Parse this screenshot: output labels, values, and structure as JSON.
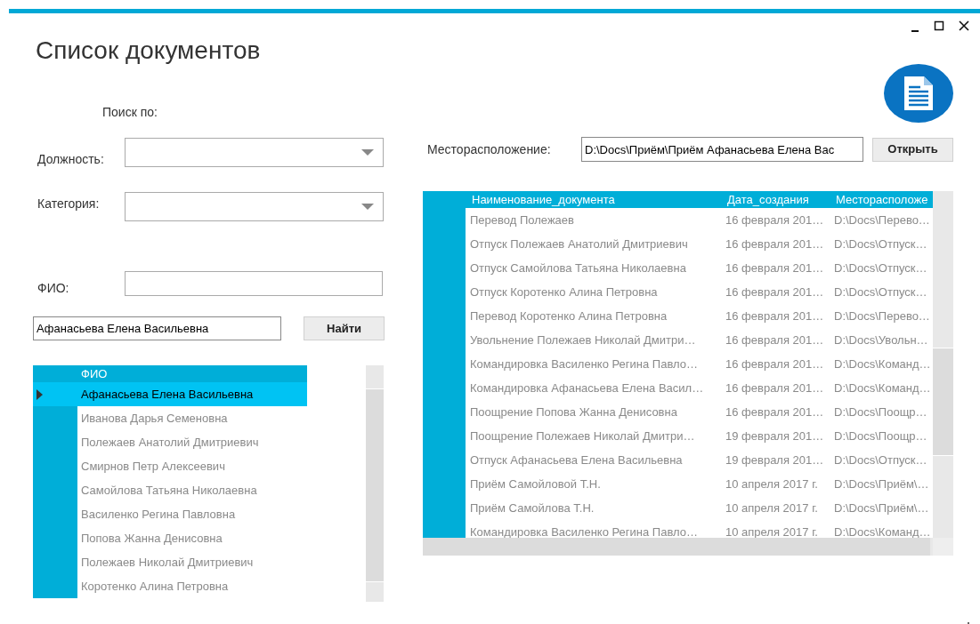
{
  "window": {
    "title": "Список документов"
  },
  "search": {
    "heading": "Поиск по:",
    "fields": [
      {
        "kind": "dropdown",
        "label": "Должность:"
      },
      {
        "kind": "dropdown",
        "label": "Категория:"
      },
      {
        "kind": "text",
        "label": "ФИО:"
      }
    ],
    "name_value": "Афанасьева Елена Васильевна",
    "find_button": "Найти"
  },
  "people_grid": {
    "columns": [
      "ФИО"
    ],
    "rows": [
      {
        "name": "Афанасьева Елена Васильевна",
        "selected": true
      },
      {
        "name": "Иванова Дарья Семеновна",
        "selected": false
      },
      {
        "name": "Полежаев Анатолий Дмитриевич",
        "selected": false
      },
      {
        "name": "Смирнов Петр Алексеевич",
        "selected": false
      },
      {
        "name": "Самойлова Татьяна Николаевна",
        "selected": false
      },
      {
        "name": "Василенко Регина Павловна",
        "selected": false
      },
      {
        "name": "Попова Жанна Денисовна",
        "selected": false
      },
      {
        "name": "Полежаев Николай Дмитриевич",
        "selected": false
      },
      {
        "name": "Коротенко Алина Петровна",
        "selected": false
      }
    ]
  },
  "location": {
    "label": "Месторасположение:",
    "value": "D:\\Docs\\Приём\\Приём Афанасьева Елена Вас",
    "open_button": "Открыть"
  },
  "documents_grid": {
    "columns": [
      "Наименование_документа",
      "Дата_создания",
      "Месторасположе"
    ],
    "rows": [
      [
        "Перевод Полежаев",
        "16 февраля 201…",
        "D:\\Docs\\Перево…"
      ],
      [
        "Отпуск Полежаев Анатолий Дмитриевич",
        "16 февраля 201…",
        "D:\\Docs\\Отпуск…"
      ],
      [
        "Отпуск Самойлова Татьяна Николаевна",
        "16 февраля 201…",
        "D:\\Docs\\Отпуск…"
      ],
      [
        "Отпуск Коротенко Алина Петровна",
        "16 февраля 201…",
        "D:\\Docs\\Отпуск…"
      ],
      [
        "Перевод Коротенко Алина Петровна",
        "16 февраля 201…",
        "D:\\Docs\\Перево…"
      ],
      [
        "Увольнение Полежаев Николай Дмитри…",
        "16 февраля 201…",
        "D:\\Docs\\Увольн…"
      ],
      [
        "Командировка Василенко Регина Павло…",
        "16 февраля 201…",
        "D:\\Docs\\Команд…"
      ],
      [
        "Командировка Афанасьева Елена Васил…",
        "16 февраля 201…",
        "D:\\Docs\\Команд…"
      ],
      [
        "Поощрение Попова Жанна Денисовна",
        "16 февраля 201…",
        "D:\\Docs\\Поощр…"
      ],
      [
        "Поощрение Полежаев Николай Дмитри…",
        "19 февраля 201…",
        "D:\\Docs\\Поощр…"
      ],
      [
        "Отпуск Афанасьева Елена Васильевна",
        "19 февраля 201…",
        "D:\\Docs\\Отпуск…"
      ],
      [
        "Приём Самойловой Т.Н.",
        "10 апреля 2017 г.",
        "D:\\Docs\\Приём\\…"
      ],
      [
        "Приём Самойлова Т.Н.",
        "10 апреля 2017 г.",
        "D:\\Docs\\Приём\\…"
      ],
      [
        "Командировка Василенко Регина Павло…",
        "10 апреля 2017 г.",
        "D:\\Docs\\Команд…"
      ]
    ]
  }
}
